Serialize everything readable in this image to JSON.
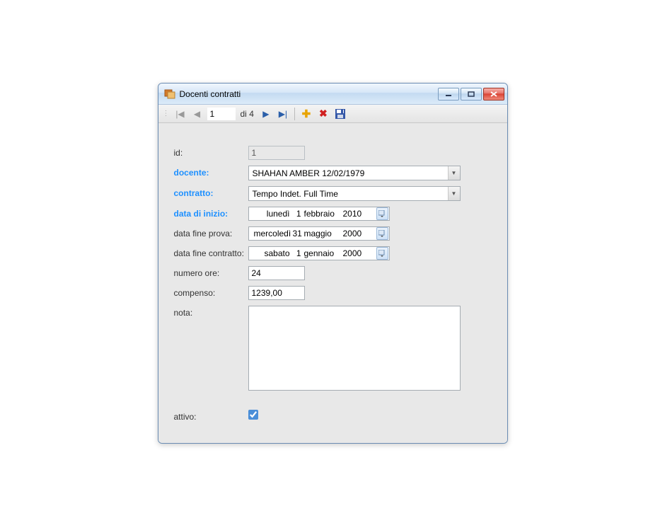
{
  "titlebar": {
    "title": "Docenti contratti"
  },
  "toolbar": {
    "position": "1",
    "count_prefix": "di",
    "count": "4"
  },
  "labels": {
    "id": "id:",
    "docente": "docente:",
    "contratto": "contratto:",
    "data_di_inizio": "data di inizio:",
    "data_fine_prova": "data fine prova:",
    "data_fine_contratto": "data fine contratto:",
    "numero_ore": "numero ore:",
    "compenso": "compenso:",
    "nota": "nota:",
    "attivo": "attivo:"
  },
  "fields": {
    "id": "1",
    "docente": "SHAHAN AMBER 12/02/1979",
    "contratto": "Tempo Indet. Full Time",
    "data_di_inizio": {
      "dow": "lunedì",
      "day": "1",
      "month": "febbraio",
      "year": "2010"
    },
    "data_fine_prova": {
      "dow": "mercoledì",
      "day": "31",
      "month": "maggio",
      "year": "2000"
    },
    "data_fine_contratto": {
      "dow": "sabato",
      "day": "1",
      "month": "gennaio",
      "year": "2000"
    },
    "numero_ore": "24",
    "compenso": "1239,00",
    "nota": "",
    "attivo": true
  }
}
